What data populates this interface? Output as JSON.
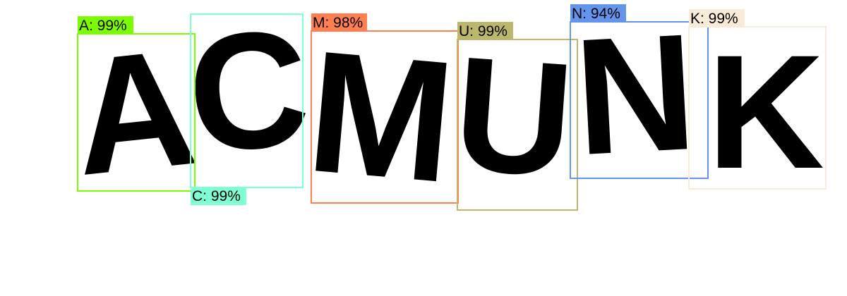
{
  "detections": [
    {
      "letter": "A",
      "label": "A: 99%",
      "color": "#7cfc00"
    },
    {
      "letter": "C",
      "label": "C: 99%",
      "color": "#7fffd4"
    },
    {
      "letter": "M",
      "label": "M: 98%",
      "color": "#ff7f50"
    },
    {
      "letter": "U",
      "label": "U: 99%",
      "color": "#bdb76b"
    },
    {
      "letter": "N",
      "label": "N: 94%",
      "color": "#6495ed"
    },
    {
      "letter": "K",
      "label": "K: 99%",
      "color": "#faebd7"
    }
  ]
}
